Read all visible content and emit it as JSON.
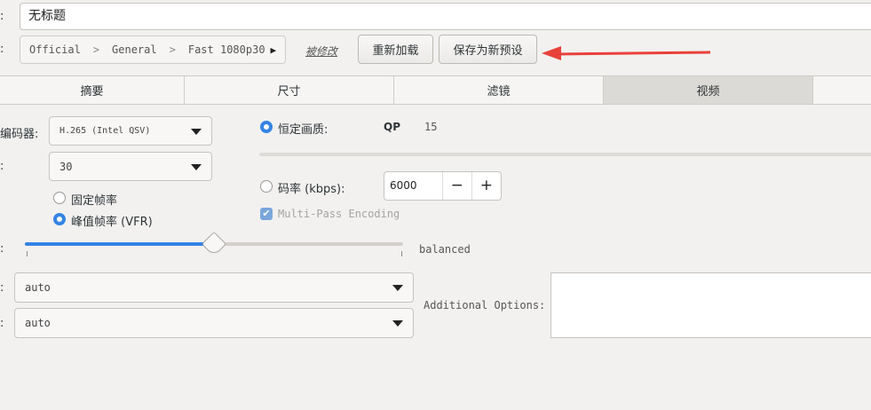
{
  "title_field": {
    "value": "无标题"
  },
  "preset": {
    "crumbs": [
      "Official",
      "General",
      "Fast 1080p30"
    ],
    "modified_label": "被修改",
    "reload_button": "重新加载",
    "save_new_button": "保存为新预设"
  },
  "tabs": [
    {
      "label": "摘要",
      "active": false
    },
    {
      "label": "尺寸",
      "active": false
    },
    {
      "label": "滤镜",
      "active": false
    },
    {
      "label": "视频",
      "active": true
    }
  ],
  "video": {
    "encoder_label": "编码器:",
    "encoder_value": "H.265 (Intel QSV)",
    "framerate_value": "30",
    "constant_framerate_label": "固定帧率",
    "peak_framerate_label": "峰值帧率 (VFR)",
    "framerate_mode": "peak",
    "preset_slider_value": "balanced",
    "tune_value": "auto",
    "profile_value": "auto",
    "quality_mode": "constant",
    "constant_quality_label": "恒定画质:",
    "qp_label": "QP",
    "qp_value": "15",
    "bitrate_label": "码率 (kbps):",
    "bitrate_value": "6000",
    "multipass_label": "Multi-Pass Encoding",
    "multipass_checked": true,
    "additional_options_label": "Additional Options:",
    "additional_options_value": "",
    "colon": ":"
  },
  "annotation": {
    "arrow_color": "#e8413a"
  },
  "colors": {
    "accent": "#3584e4",
    "active_tab": "#dcdad6"
  }
}
